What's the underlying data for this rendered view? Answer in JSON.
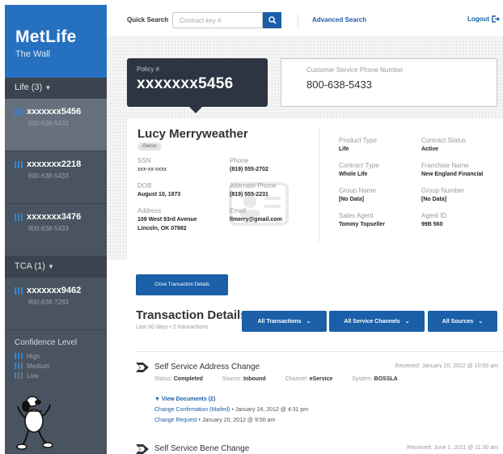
{
  "sidebar": {
    "brand_name": "MetLife",
    "brand_sub": "The Wall",
    "life_section": "Life (3)",
    "tca_section": "TCA (1)",
    "life_items": [
      {
        "policy": "xxxxxxx5456",
        "phone": "800-638-5433"
      },
      {
        "policy": "xxxxxxx2218",
        "phone": "800-638-5433"
      },
      {
        "policy": "xxxxxxx3476",
        "phone": "800-638-5433"
      }
    ],
    "tca_items": [
      {
        "policy": "xxxxxxx9462",
        "phone": "800-638-7283"
      }
    ],
    "confidence": {
      "title": "Confidence Level",
      "levels": [
        "High",
        "Medium",
        "Low"
      ]
    }
  },
  "topbar": {
    "quick_search_label": "Quick Search",
    "search_placeholder": "Contract key #",
    "search_value": "",
    "advanced_search": "Advanced Search",
    "logout": "Logout"
  },
  "policy": {
    "label": "Policy #",
    "number": "xxxxxxx5456"
  },
  "customer_service": {
    "label": "Customer Service Phone Number",
    "phone": "800-638-5433"
  },
  "customer": {
    "name": "Lucy Merryweather",
    "role": "Owner",
    "ssn_label": "SSN",
    "ssn": "xxx-xx-xxxx",
    "phone_label": "Phone",
    "phone": "(819) 555-2702",
    "dob_label": "DOB",
    "dob": "August 10, 1973",
    "alt_phone_label": "Alternate Phone",
    "alt_phone": "(819) 555-2231",
    "address_label": "Address",
    "address_line1": "109 West 93rd Avenue",
    "address_line2": "Lincoln, OK 07882",
    "email_label": "Email",
    "email": "llmerry@gmail.com"
  },
  "contract": {
    "product_type_label": "Product Type",
    "product_type": "Life",
    "contract_status_label": "Contract Status",
    "contract_status": "Active",
    "contract_type_label": "Contract Type",
    "contract_type": "Whole Life",
    "franchise_name_label": "Franchise Name",
    "franchise_name": "New England Financial",
    "group_name_label": "Group Name",
    "group_name": "[No Data]",
    "group_number_label": "Group Number",
    "group_number": "[No Data]",
    "sales_agent_label": "Sales Agent",
    "sales_agent": "Tommy Topseller",
    "agent_id_label": "Agent ID",
    "agent_id": "99B 560"
  },
  "transactions": {
    "close_button": "Close Transaction Details",
    "title": "Transaction Details",
    "subtitle": "Last 60 days • 2 transactions",
    "filters": [
      "All Transactions",
      "All Service Channels",
      "All Sources"
    ],
    "items": [
      {
        "name": "Self Service Address Change",
        "received": "Received: January 20, 2012 @ 10:00 am",
        "status_label": "Status:",
        "status": "Completed",
        "source_label": "Source:",
        "source": "Inbound",
        "channel_label": "Channel:",
        "channel": "eService",
        "system_label": "System:",
        "system": "BOSSLA",
        "docs_toggle": "View Documents (2)",
        "docs": [
          {
            "link": "Change Confirmation (Mailed)",
            "date": " • January 24, 2012 @ 4:31 pm"
          },
          {
            "link": "Change Request",
            "date": " • January 20, 2012 @ 9:50 am"
          }
        ]
      },
      {
        "name": "Self Service Bene Change",
        "received": "Received: June 1, 2011 @ 11:30 am"
      }
    ]
  },
  "colors": {
    "brand_blue": "#2670c0",
    "action_blue": "#1a5fa8",
    "sidebar_bg": "#4a5460",
    "policy_card_bg": "#2c3541"
  }
}
